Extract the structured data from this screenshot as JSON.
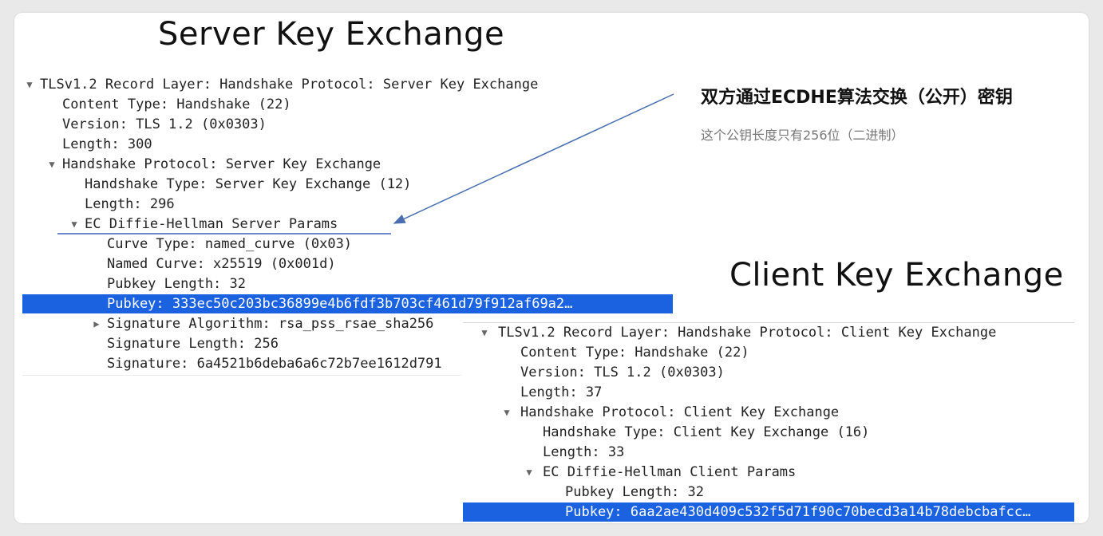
{
  "server": {
    "title": "Server Key Exchange",
    "rows": [
      {
        "toggle": "▼",
        "text": "TLSv1.2 Record Layer: Handshake Protocol: Server Key Exchange"
      },
      {
        "toggle": "",
        "text": "Content Type: Handshake (22)"
      },
      {
        "toggle": "",
        "text": "Version: TLS 1.2 (0x0303)"
      },
      {
        "toggle": "",
        "text": "Length: 300"
      },
      {
        "toggle": "▼",
        "text": "Handshake Protocol: Server Key Exchange"
      },
      {
        "toggle": "",
        "text": "Handshake Type: Server Key Exchange (12)"
      },
      {
        "toggle": "",
        "text": "Length: 296"
      },
      {
        "toggle": "▼",
        "text": "EC Diffie-Hellman Server Params"
      },
      {
        "toggle": "",
        "text": "Curve Type: named_curve (0x03)"
      },
      {
        "toggle": "",
        "text": "Named Curve: x25519 (0x001d)"
      },
      {
        "toggle": "",
        "text": "Pubkey Length: 32"
      },
      {
        "toggle": "",
        "text": "Pubkey: 333ec50c203bc36899e4b6fdf3b703cf461d79f912af69a2…"
      },
      {
        "toggle": "▶",
        "text": "Signature Algorithm: rsa_pss_rsae_sha256"
      },
      {
        "toggle": "",
        "text": "Signature Length: 256"
      },
      {
        "toggle": "",
        "text": "Signature: 6a4521b6deba6a6c72b7ee1612d791"
      }
    ]
  },
  "client": {
    "title": "Client Key Exchange",
    "rows": [
      {
        "toggle": "▼",
        "text": "TLSv1.2 Record Layer: Handshake Protocol: Client Key Exchange"
      },
      {
        "toggle": "",
        "text": "Content Type: Handshake (22)"
      },
      {
        "toggle": "",
        "text": "Version: TLS 1.2 (0x0303)"
      },
      {
        "toggle": "",
        "text": "Length: 37"
      },
      {
        "toggle": "▼",
        "text": "Handshake Protocol: Client Key Exchange"
      },
      {
        "toggle": "",
        "text": "Handshake Type: Client Key Exchange (16)"
      },
      {
        "toggle": "",
        "text": "Length: 33"
      },
      {
        "toggle": "▼",
        "text": "EC Diffie-Hellman Client Params"
      },
      {
        "toggle": "",
        "text": "Pubkey Length: 32"
      },
      {
        "toggle": "",
        "text": "Pubkey: 6aa2ae430d409c532f5d71f90c70becd3a14b78debcbafcc…"
      }
    ]
  },
  "annotation": {
    "title": "双方通过ECDHE算法交换（公开）密钥",
    "subtitle": "这个公钥长度只有256位（二进制）"
  },
  "colors": {
    "selection": "#1a62e0",
    "arrow": "#4a6fb0",
    "underline": "#3a62b8"
  }
}
